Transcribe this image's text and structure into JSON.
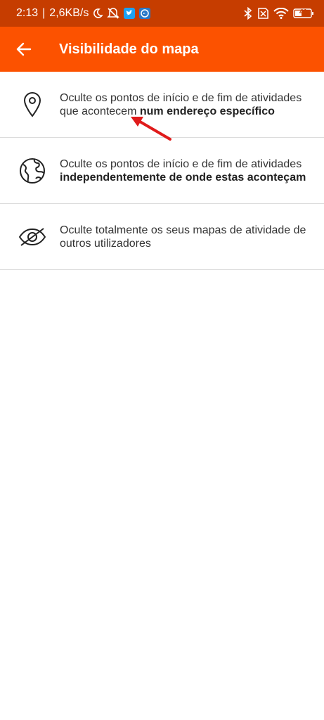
{
  "status_bar": {
    "time": "2:13",
    "separator": "|",
    "speed": "2,6KB/s",
    "battery": "41",
    "icons": [
      "moon-icon",
      "mute-icon",
      "twitter-icon",
      "app-icon",
      "bluetooth-icon",
      "no-sim-icon",
      "wifi-icon",
      "battery-icon"
    ]
  },
  "app_bar": {
    "title": "Visibilidade do mapa",
    "back_icon": "arrow-left-icon",
    "background": "#fc5200"
  },
  "options": [
    {
      "icon": "map-pin-icon",
      "text_normal": "Oculte os pontos de início e de fim de atividades que acontecem ",
      "text_bold": "num endereço específico"
    },
    {
      "icon": "globe-icon",
      "text_normal": "Oculte os pontos de início e de fim de atividades ",
      "text_bold": "independentemente de onde estas aconteçam"
    },
    {
      "icon": "eye-off-icon",
      "text_normal": "Oculte totalmente os seus mapas de atividade de outros utilizadores",
      "text_bold": ""
    }
  ],
  "annotation": {
    "arrow_color": "#e01b1b"
  }
}
